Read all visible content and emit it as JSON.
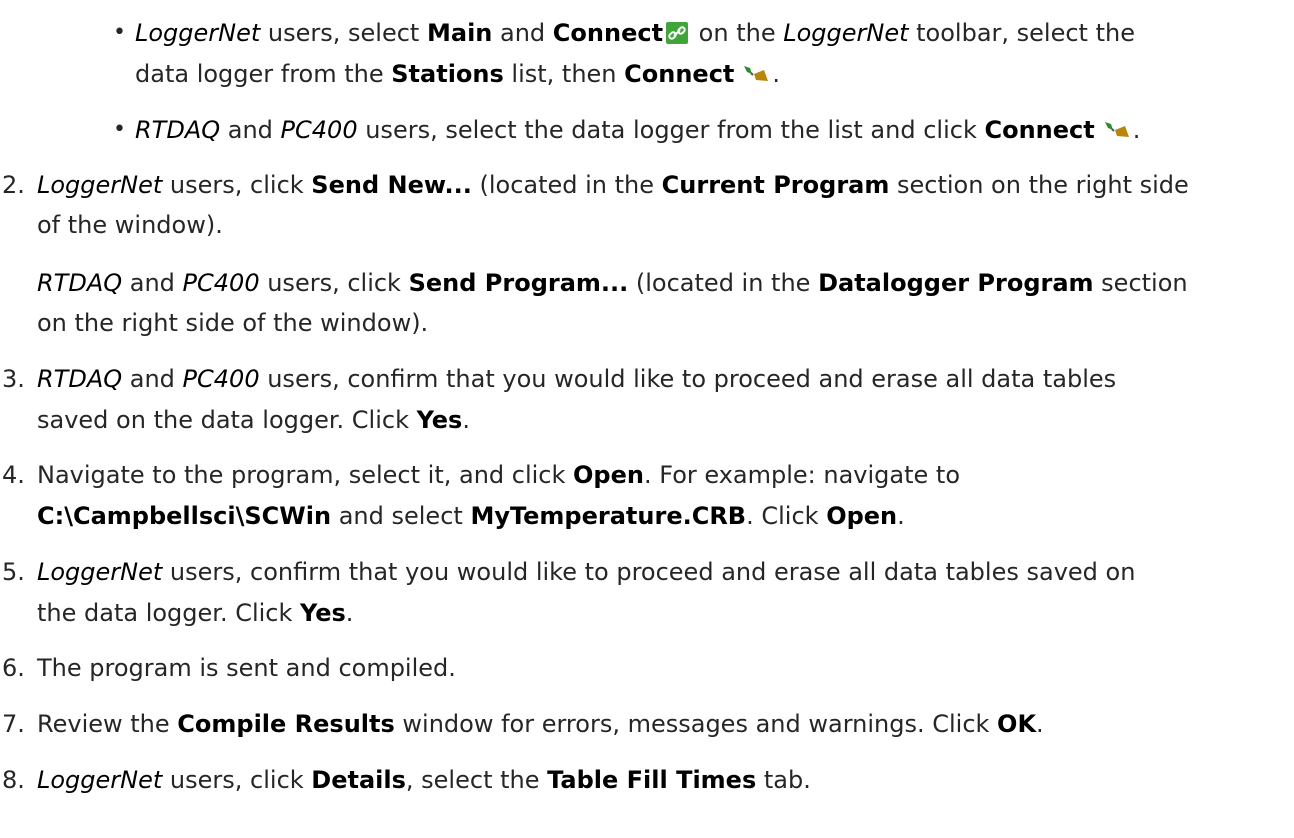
{
  "bullets": [
    {
      "parts": [
        {
          "t": "LoggerNet",
          "s": "i"
        },
        {
          "t": " users, select "
        },
        {
          "t": "Main",
          "s": "b"
        },
        {
          "t": " and "
        },
        {
          "t": "Connect",
          "s": "b"
        },
        {
          "icon": "link-icon"
        },
        {
          "t": " on the "
        },
        {
          "t": "LoggerNet",
          "s": "i"
        },
        {
          "t": " toolbar, select the"
        }
      ],
      "parts2": [
        {
          "t": "data logger from the "
        },
        {
          "t": "Stations",
          "s": "b"
        },
        {
          "t": " list, then "
        },
        {
          "t": "Connect",
          "s": "b"
        },
        {
          "icon": "plug-icon"
        },
        {
          "t": "."
        }
      ]
    },
    {
      "parts": [
        {
          "t": "RTDAQ",
          "s": "i"
        },
        {
          "t": " and "
        },
        {
          "t": "PC400",
          "s": "i"
        },
        {
          "t": " users, select the data logger from the list and click "
        },
        {
          "t": "Connect",
          "s": "b"
        },
        {
          "icon": "plug-icon"
        },
        {
          "t": "."
        }
      ]
    }
  ],
  "steps": [
    {
      "number": "2.",
      "lines": [
        [
          {
            "t": "LoggerNet",
            "s": "i"
          },
          {
            "t": " users, click "
          },
          {
            "t": "Send New...",
            "s": "b"
          },
          {
            "t": " (located in the "
          },
          {
            "t": "Current Program",
            "s": "b"
          },
          {
            "t": " section on the right side"
          }
        ],
        [
          {
            "t": "of the window)."
          }
        ],
        [
          {
            "t": "RTDAQ",
            "s": "i"
          },
          {
            "t": " and "
          },
          {
            "t": "PC400",
            "s": "i"
          },
          {
            "t": " users, click "
          },
          {
            "t": "Send Program...",
            "s": "b"
          },
          {
            "t": " (located in the "
          },
          {
            "t": "Datalogger Program",
            "s": "b"
          },
          {
            "t": " section"
          }
        ],
        [
          {
            "t": "on the right side of the window)."
          }
        ]
      ]
    },
    {
      "number": "3.",
      "lines": [
        [
          {
            "t": "RTDAQ",
            "s": "i"
          },
          {
            "t": " and "
          },
          {
            "t": "PC400",
            "s": "i"
          },
          {
            "t": " users, confirm that you would like to proceed and erase all data tables"
          }
        ],
        [
          {
            "t": "saved on the data logger. Click "
          },
          {
            "t": "Yes",
            "s": "b"
          },
          {
            "t": "."
          }
        ]
      ]
    },
    {
      "number": "4.",
      "lines": [
        [
          {
            "t": "Navigate to the program, select it, and click "
          },
          {
            "t": "Open",
            "s": "b"
          },
          {
            "t": ". For example: navigate to"
          }
        ],
        [
          {
            "t": "C:\\Campbellsci\\SCWin",
            "s": "b"
          },
          {
            "t": " and select "
          },
          {
            "t": "MyTemperature.CRB",
            "s": "b"
          },
          {
            "t": ". Click "
          },
          {
            "t": "Open",
            "s": "b"
          },
          {
            "t": "."
          }
        ]
      ]
    },
    {
      "number": "5.",
      "lines": [
        [
          {
            "t": "LoggerNet",
            "s": "i"
          },
          {
            "t": " users, confirm that you would like to proceed and erase all data tables saved on"
          }
        ],
        [
          {
            "t": "the data logger. Click "
          },
          {
            "t": "Yes",
            "s": "b"
          },
          {
            "t": "."
          }
        ]
      ]
    },
    {
      "number": "6.",
      "lines": [
        [
          {
            "t": "The program is sent and compiled."
          }
        ]
      ]
    },
    {
      "number": "7.",
      "lines": [
        [
          {
            "t": "Review the "
          },
          {
            "t": "Compile Results",
            "s": "b"
          },
          {
            "t": " window for errors, messages and warnings. Click "
          },
          {
            "t": "OK",
            "s": "b"
          },
          {
            "t": "."
          }
        ]
      ]
    },
    {
      "number": "8.",
      "lines": [
        [
          {
            "t": "LoggerNet",
            "s": "i"
          },
          {
            "t": " users, click "
          },
          {
            "t": "Details",
            "s": "b"
          },
          {
            "t": ", select the "
          },
          {
            "t": "Table Fill Times",
            "s": "b"
          },
          {
            "t": " tab."
          }
        ]
      ]
    }
  ],
  "colors": {
    "text": "#262626",
    "link_icon_bg": "#3fa53a",
    "plug_icon_green": "#2e8b2e",
    "plug_icon_gold": "#b8860b"
  }
}
